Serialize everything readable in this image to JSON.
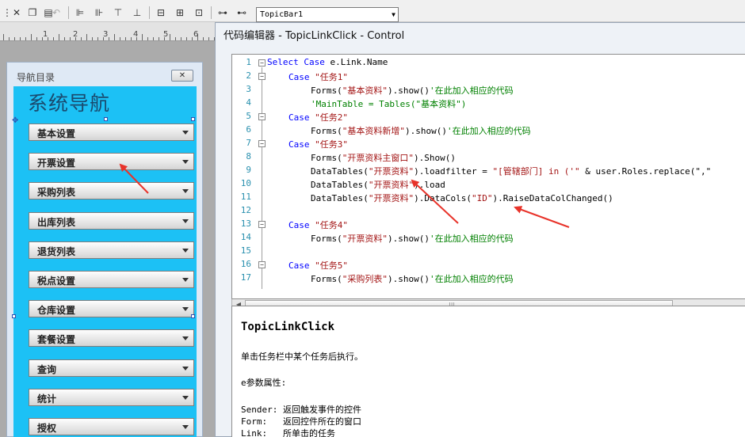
{
  "toolbar": {
    "topic_select_value": "TopicBar1",
    "icons": [
      "cut-icon",
      "copy-icon",
      "paste-icon",
      "undo-icon",
      "align-left-icon",
      "align-right-icon",
      "align-top-icon",
      "align-bottom-icon",
      "same-width-icon",
      "same-height-icon",
      "same-size-icon",
      "tab-order-icon",
      "distribute-icon"
    ]
  },
  "ruler": {
    "labels": [
      "1",
      "2",
      "3",
      "4",
      "5",
      "6"
    ]
  },
  "nav_panel": {
    "header_title": "导航目录",
    "close_glyph": "✕",
    "big_title": "系统导航",
    "items": [
      "基本设置",
      "开票设置",
      "采购列表",
      "出库列表",
      "退货列表",
      "税点设置",
      "仓库设置",
      "套餐设置",
      "查询",
      "统计",
      "授权"
    ]
  },
  "editor": {
    "title": "代码编辑器 - TopicLinkClick - Control",
    "line_numbers": [
      "1",
      "2",
      "3",
      "4",
      "5",
      "6",
      "7",
      "8",
      "9",
      "10",
      "11",
      "12",
      "13",
      "14",
      "15",
      "16",
      "17"
    ],
    "code": {
      "l1_kw": "Select Case",
      "l1_rest": " e.Link.Name",
      "l2_kw": "Case",
      "l2_str": " \"任务1\"",
      "l3_a": "Forms(",
      "l3_str": "\"基本资料\"",
      "l3_b": ").show()",
      "l3_cmt": "'在此加入相应的代码",
      "l4_cmt": "'MainTable = Tables(\"基本资料\")",
      "l5_kw": "Case",
      "l5_str": " \"任务2\"",
      "l6_a": "Forms(",
      "l6_str": "\"基本资料新增\"",
      "l6_b": ").show()",
      "l6_cmt": "'在此加入相应的代码",
      "l7_kw": "Case",
      "l7_str": " \"任务3\"",
      "l8_a": "Forms(",
      "l8_str": "\"开票资料主窗口\"",
      "l8_b": ").Show()",
      "l9_a": "DataTables(",
      "l9_str": "\"开票资料\"",
      "l9_b": ").loadfilter = ",
      "l9_str2": "\"[管辖部门] in ('\"",
      "l9_c": " & user.Roles.replace(\",\"",
      "l10_a": "DataTables(",
      "l10_str": "\"开票资料\"",
      "l10_b": ").load",
      "l11_a": "DataTables(",
      "l11_str": "\"开票资料\"",
      "l11_b": ").DataCols(",
      "l11_str2": "\"ID\"",
      "l11_c": ").RaiseDataColChanged()",
      "l13_kw": "Case",
      "l13_str": " \"任务4\"",
      "l14_a": "Forms(",
      "l14_str": "\"开票资料\"",
      "l14_b": ").show()",
      "l14_cmt": "'在此加入相应的代码",
      "l16_kw": "Case",
      "l16_str": " \"任务5\"",
      "l17_a": "Forms(",
      "l17_str": "\"采购列表\"",
      "l17_b": ").show()",
      "l17_cmt": "'在此加入相应的代码"
    },
    "help": {
      "title": "TopicLinkClick",
      "desc": "单击任务栏中某个任务后执行。",
      "param_heading": "e参数属性:",
      "sender": "Sender: 返回触发事件的控件",
      "form": "Form:   返回控件所在的窗口",
      "link": "Link:   所单击的任务"
    }
  },
  "colors": {
    "nav_body": "#1cc1f5",
    "keyword": "#0000ff",
    "string": "#a31515",
    "comment": "#008000",
    "annotation_arrow": "#e8332a"
  }
}
